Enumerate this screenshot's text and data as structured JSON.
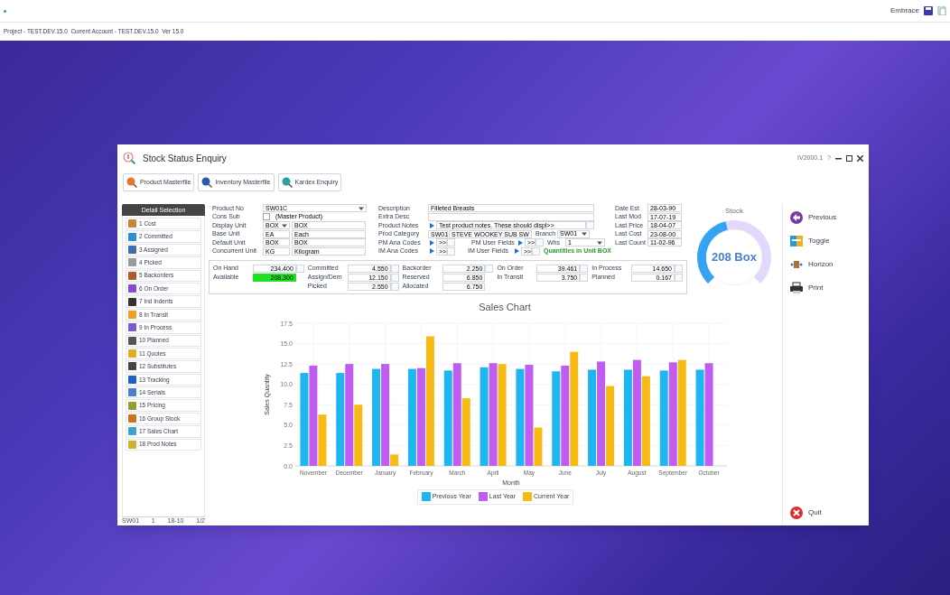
{
  "top_bar": {
    "user": "Embrace"
  },
  "status_line": "Project - TEST.DEV.15.0  Current Account - TEST.DEV.15.0  Ver 15.0",
  "window": {
    "title": "Stock Status Enquiry",
    "code": "IV2000.1",
    "help": "?"
  },
  "toolbar": [
    "Product Masterfile",
    "Inventory Masterfile",
    "Kardex Enquiry"
  ],
  "detail_selection": {
    "title": "Detail Selection",
    "items": [
      "1 Cost",
      "2 Committed",
      "3 Assigned",
      "4 Picked",
      "5 Backorders",
      "6 On Order",
      "7 Ind Indents",
      "8 In Transit",
      "9 In Process",
      "10 Planned",
      "11 Quotes",
      "12 Substitutes",
      "13 Tracking",
      "14 Serials",
      "15 Pricing",
      "16 Group Stock",
      "17 Sales Chart",
      "18 Prod Notes"
    ],
    "status": [
      "SW01",
      "1",
      "18-10",
      "1/2"
    ]
  },
  "form_left": [
    {
      "label": "Product No",
      "kind": "select-wide",
      "value": "SW01C"
    },
    {
      "label": "Cons Sub",
      "kind": "checkbox",
      "checked": false,
      "text": "(Master Product)"
    },
    {
      "label": "Display Unit",
      "kind": "select-desc",
      "value": "BOX",
      "desc": "BOX"
    },
    {
      "label": "Base Unit",
      "kind": "code-desc",
      "value": "EA",
      "desc": "Each"
    },
    {
      "label": "Default Unit",
      "kind": "code-desc",
      "value": "BOX",
      "desc": "BOX"
    },
    {
      "label": "Concurrent Unit",
      "kind": "code-desc",
      "value": "KG",
      "desc": "Kilogram"
    }
  ],
  "form_middle": [
    {
      "label": "Description",
      "kind": "wide",
      "value": "Filleted Breasts"
    },
    {
      "label": "Extra Desc",
      "kind": "wide"
    },
    {
      "label": "Product Notes",
      "kind": "notes",
      "value": "Test product notes. These should displ>>"
    },
    {
      "label": "Prod Category",
      "kind": "category",
      "value": "SW01",
      "desc": "STEVE WOOKEY SUB SW",
      "sub_label": "Branch",
      "sub_value": "SW01"
    },
    {
      "label": "PM Ana Codes",
      "kind": "codes",
      "value": ">>",
      "sub_label": "PM User Fields",
      "sub_value": ">>",
      "extra_label": "Whs",
      "extra_value": "1"
    },
    {
      "label": "IM Ana Codes",
      "kind": "codes",
      "value": ">>",
      "sub_label": "IM User Fields",
      "sub_value": ">>",
      "note": "Quantities in Unit BOX"
    }
  ],
  "form_right": [
    {
      "label": "Date Est",
      "value": "28-03-90"
    },
    {
      "label": "Last Mod",
      "value": "17-07-19"
    },
    {
      "label": "Last Price",
      "value": "18-04-07"
    },
    {
      "label": "Last Cost",
      "value": "23-08-00"
    },
    {
      "label": "Last Count",
      "value": "11-02-96"
    }
  ],
  "quantities": [
    [
      {
        "label": "On Hand",
        "value": "234.400",
        "button": true,
        "highlight": false
      },
      {
        "label": "Available",
        "value": "208.300",
        "button": false,
        "highlight": true
      }
    ],
    [
      {
        "label": "Committed",
        "value": "4.550",
        "button": true,
        "highlight": false
      },
      {
        "label": "Assign/Dem",
        "value": "12.150",
        "button": true,
        "highlight": false
      },
      {
        "label": "Picked",
        "value": "2.550",
        "button": true,
        "highlight": false
      }
    ],
    [
      {
        "label": "Backorder",
        "value": "2.250",
        "button": true,
        "highlight": false
      },
      {
        "label": "Reserved",
        "value": "6.850",
        "button": false,
        "highlight": false
      },
      {
        "label": "Allocated",
        "value": "6.750",
        "button": false,
        "highlight": false
      }
    ],
    [
      {
        "label": "On Order",
        "value": "39.461",
        "button": true,
        "highlight": false
      },
      {
        "label": "In Transit",
        "value": "3.750",
        "button": true,
        "highlight": false
      }
    ],
    [
      {
        "label": "In Process",
        "value": "14.650",
        "button": true,
        "highlight": false
      },
      {
        "label": "Planned",
        "value": "0.167",
        "button": true,
        "highlight": false
      }
    ]
  ],
  "stock": {
    "title": "Stock",
    "value": "208 Box"
  },
  "actions": [
    "Previous",
    "Toggle",
    "Horizon",
    "Print"
  ],
  "quit": "Quit",
  "sales_chart": {
    "chart_data": {
      "type": "bar",
      "title": "Sales Chart",
      "xlabel": "Month",
      "ylabel": "Sales Quantity",
      "categories": [
        "November",
        "December",
        "January",
        "February",
        "March",
        "April",
        "May",
        "June",
        "July",
        "August",
        "September",
        "October"
      ],
      "ylim": [
        0,
        17.5
      ],
      "grid": true,
      "legend": true,
      "yticks": [
        {
          "value": 0,
          "label": "0.0"
        },
        {
          "value": 2.5,
          "label": "2.5"
        },
        {
          "value": 5,
          "label": "5.0"
        },
        {
          "value": 7.5,
          "label": "7.5"
        },
        {
          "value": 10,
          "label": "10.0"
        },
        {
          "value": 12.5,
          "label": "12.5"
        },
        {
          "value": 15,
          "label": "15.0"
        },
        {
          "value": 17.5,
          "label": "17.5"
        }
      ],
      "series": [
        {
          "name": "Previous Year",
          "color": "#1eb6f0",
          "values": [
            11.4,
            11.4,
            11.9,
            11.9,
            11.7,
            12.1,
            11.9,
            11.6,
            11.8,
            11.8,
            11.7,
            11.8
          ]
        },
        {
          "name": "Last Year",
          "color": "#c05cf2",
          "values": [
            12.3,
            12.5,
            12.5,
            12.0,
            12.6,
            12.6,
            12.4,
            12.3,
            12.8,
            13.0,
            12.7,
            12.6
          ]
        },
        {
          "name": "Current Year",
          "color": "#f8bb14",
          "values": [
            6.3,
            7.5,
            1.4,
            15.9,
            8.3,
            12.5,
            4.7,
            14.0,
            9.8,
            11.0,
            13.0,
            null
          ]
        }
      ]
    }
  }
}
